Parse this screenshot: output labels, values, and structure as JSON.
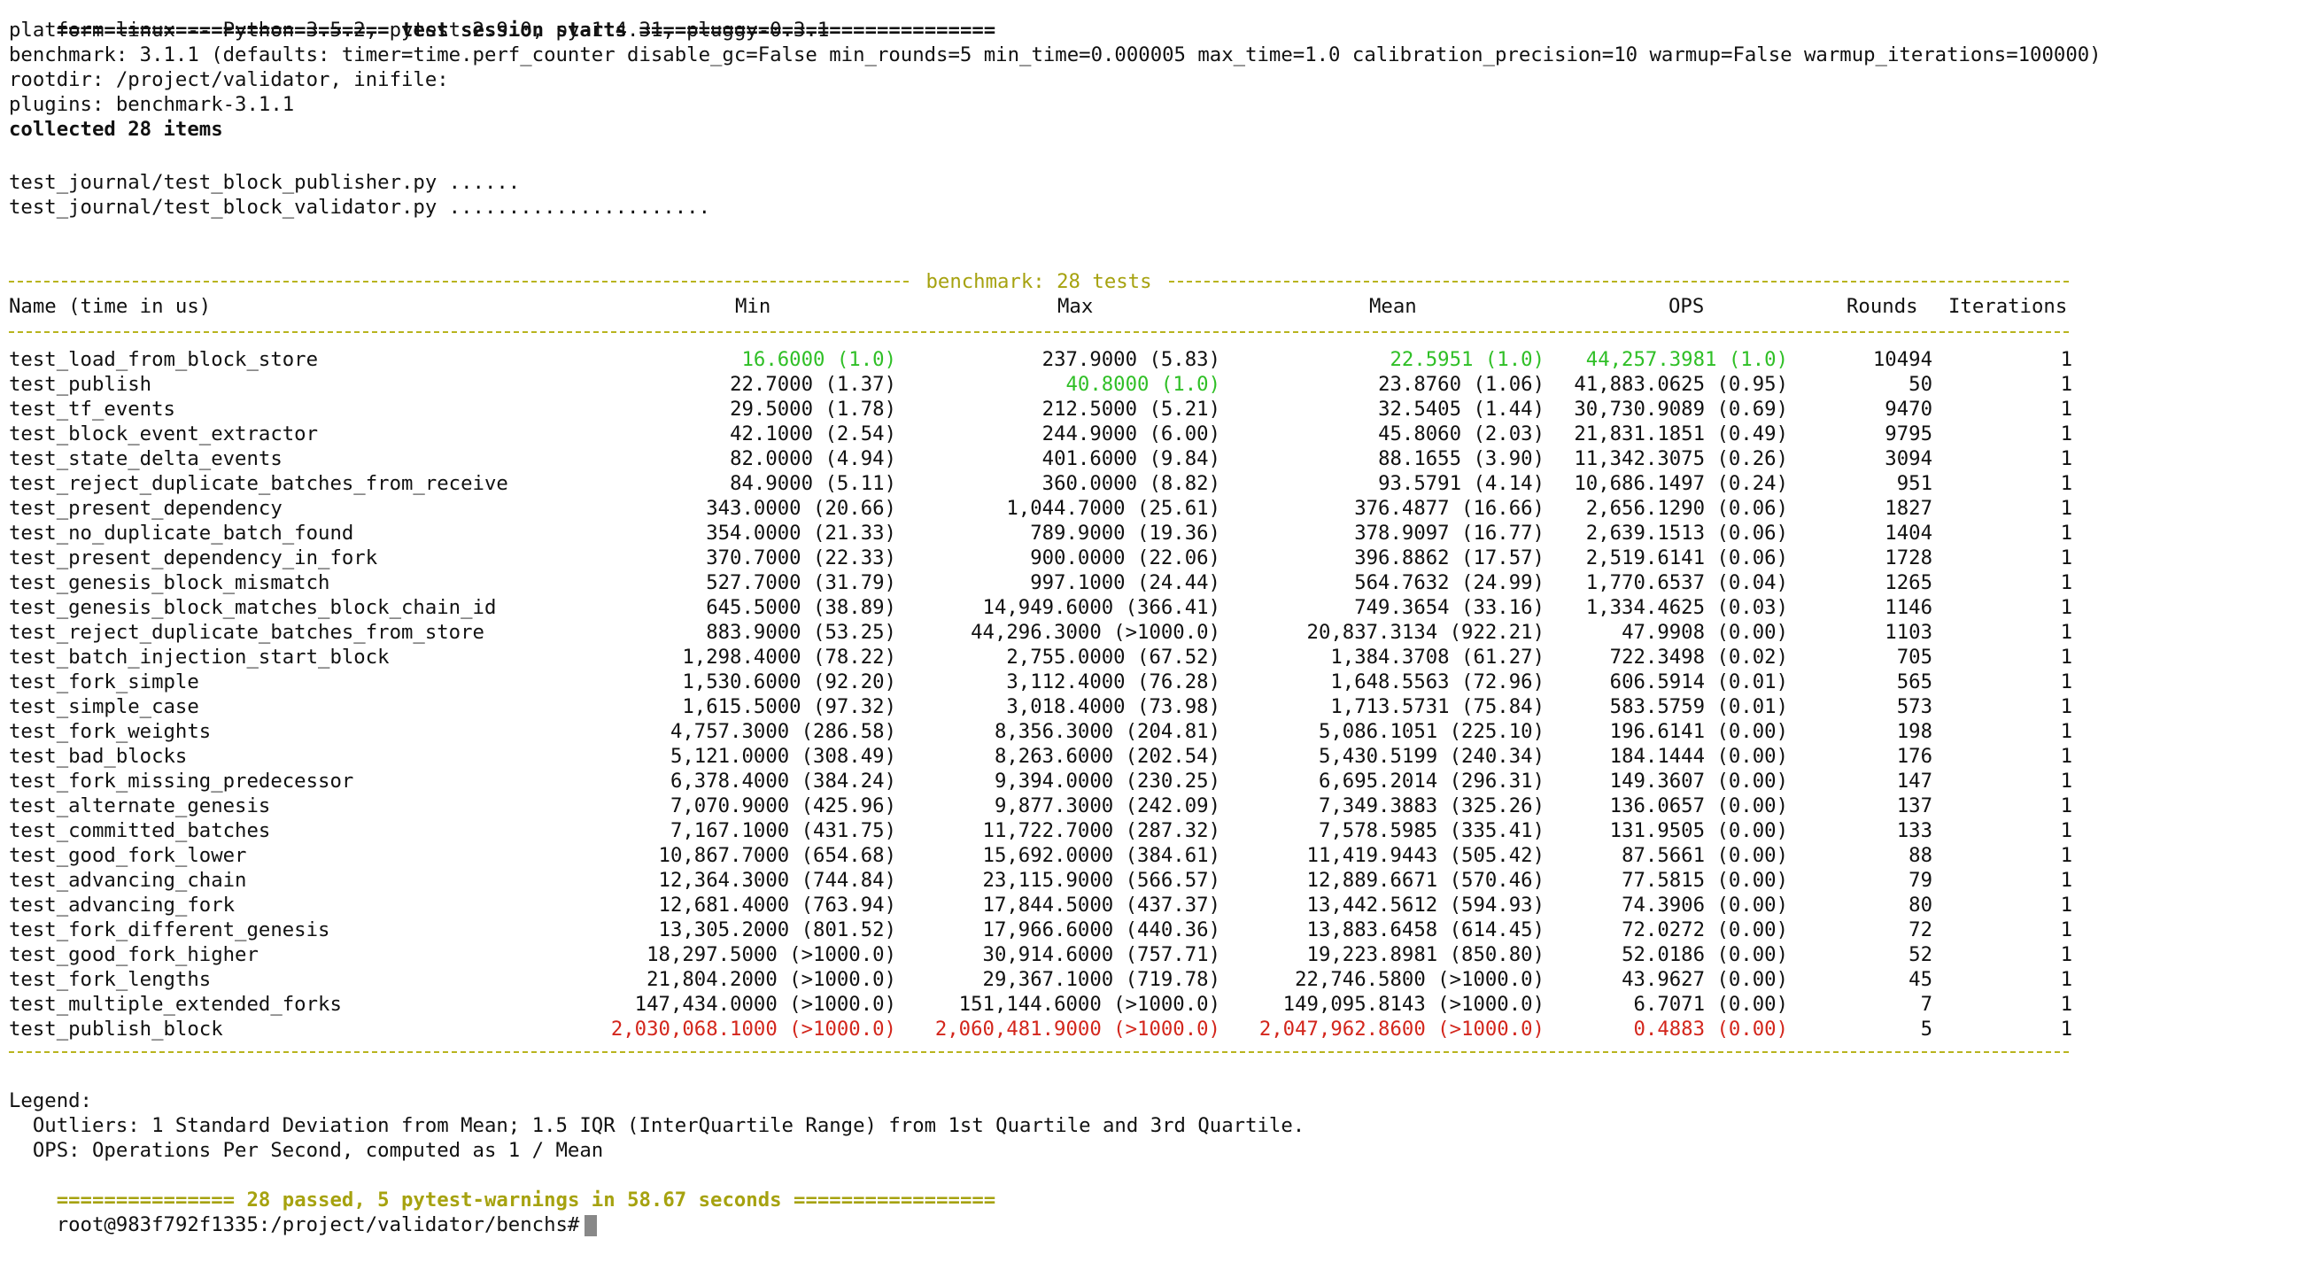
{
  "session_header": {
    "bar_left": "============================",
    "title": "test session starts",
    "bar_right": "=============================="
  },
  "platform_line": "platform linux -- Python 3.5.2, pytest-2.9.0, py-1.4.31, pluggy-0.3.1",
  "benchmark_line": "benchmark: 3.1.1 (defaults: timer=time.perf_counter disable_gc=False min_rounds=5 min_time=0.000005 max_time=1.0 calibration_precision=10 warmup=False warmup_iterations=100000)",
  "rootdir_line": "rootdir: /project/validator, inifile:",
  "plugins_line": "plugins: benchmark-3.1.1",
  "collected_line": "collected 28 items",
  "test_files": [
    "test_journal/test_block_publisher.py ......",
    "test_journal/test_block_validator.py ......................"
  ],
  "bench_table": {
    "title": "benchmark: 28 tests",
    "headers": {
      "name": "Name (time in us)",
      "min": "Min",
      "max": "Max",
      "mean": "Mean",
      "ops": "OPS",
      "rounds": "Rounds",
      "iterations": "Iterations"
    },
    "rows": [
      {
        "name": "test_load_from_block_store",
        "min": "16.6000 (1.0)",
        "max": "237.9000 (5.83)",
        "mean": "22.5951 (1.0)",
        "ops": "44,257.3981 (1.0)",
        "rounds": "10494",
        "iterations": "1"
      },
      {
        "name": "test_publish",
        "min": "22.7000 (1.37)",
        "max": "40.8000 (1.0)",
        "mean": "23.8760 (1.06)",
        "ops": "41,883.0625 (0.95)",
        "rounds": "50",
        "iterations": "1"
      },
      {
        "name": "test_tf_events",
        "min": "29.5000 (1.78)",
        "max": "212.5000 (5.21)",
        "mean": "32.5405 (1.44)",
        "ops": "30,730.9089 (0.69)",
        "rounds": "9470",
        "iterations": "1"
      },
      {
        "name": "test_block_event_extractor",
        "min": "42.1000 (2.54)",
        "max": "244.9000 (6.00)",
        "mean": "45.8060 (2.03)",
        "ops": "21,831.1851 (0.49)",
        "rounds": "9795",
        "iterations": "1"
      },
      {
        "name": "test_state_delta_events",
        "min": "82.0000 (4.94)",
        "max": "401.6000 (9.84)",
        "mean": "88.1655 (3.90)",
        "ops": "11,342.3075 (0.26)",
        "rounds": "3094",
        "iterations": "1"
      },
      {
        "name": "test_reject_duplicate_batches_from_receive",
        "min": "84.9000 (5.11)",
        "max": "360.0000 (8.82)",
        "mean": "93.5791 (4.14)",
        "ops": "10,686.1497 (0.24)",
        "rounds": "951",
        "iterations": "1"
      },
      {
        "name": "test_present_dependency",
        "min": "343.0000 (20.66)",
        "max": "1,044.7000 (25.61)",
        "mean": "376.4877 (16.66)",
        "ops": "2,656.1290 (0.06)",
        "rounds": "1827",
        "iterations": "1"
      },
      {
        "name": "test_no_duplicate_batch_found",
        "min": "354.0000 (21.33)",
        "max": "789.9000 (19.36)",
        "mean": "378.9097 (16.77)",
        "ops": "2,639.1513 (0.06)",
        "rounds": "1404",
        "iterations": "1"
      },
      {
        "name": "test_present_dependency_in_fork",
        "min": "370.7000 (22.33)",
        "max": "900.0000 (22.06)",
        "mean": "396.8862 (17.57)",
        "ops": "2,519.6141 (0.06)",
        "rounds": "1728",
        "iterations": "1"
      },
      {
        "name": "test_genesis_block_mismatch",
        "min": "527.7000 (31.79)",
        "max": "997.1000 (24.44)",
        "mean": "564.7632 (24.99)",
        "ops": "1,770.6537 (0.04)",
        "rounds": "1265",
        "iterations": "1"
      },
      {
        "name": "test_genesis_block_matches_block_chain_id",
        "min": "645.5000 (38.89)",
        "max": "14,949.6000 (366.41)",
        "mean": "749.3654 (33.16)",
        "ops": "1,334.4625 (0.03)",
        "rounds": "1146",
        "iterations": "1"
      },
      {
        "name": "test_reject_duplicate_batches_from_store",
        "min": "883.9000 (53.25)",
        "max": "44,296.3000 (>1000.0)",
        "mean": "20,837.3134 (922.21)",
        "ops": "47.9908 (0.00)",
        "rounds": "1103",
        "iterations": "1"
      },
      {
        "name": "test_batch_injection_start_block",
        "min": "1,298.4000 (78.22)",
        "max": "2,755.0000 (67.52)",
        "mean": "1,384.3708 (61.27)",
        "ops": "722.3498 (0.02)",
        "rounds": "705",
        "iterations": "1"
      },
      {
        "name": "test_fork_simple",
        "min": "1,530.6000 (92.20)",
        "max": "3,112.4000 (76.28)",
        "mean": "1,648.5563 (72.96)",
        "ops": "606.5914 (0.01)",
        "rounds": "565",
        "iterations": "1"
      },
      {
        "name": "test_simple_case",
        "min": "1,615.5000 (97.32)",
        "max": "3,018.4000 (73.98)",
        "mean": "1,713.5731 (75.84)",
        "ops": "583.5759 (0.01)",
        "rounds": "573",
        "iterations": "1"
      },
      {
        "name": "test_fork_weights",
        "min": "4,757.3000 (286.58)",
        "max": "8,356.3000 (204.81)",
        "mean": "5,086.1051 (225.10)",
        "ops": "196.6141 (0.00)",
        "rounds": "198",
        "iterations": "1"
      },
      {
        "name": "test_bad_blocks",
        "min": "5,121.0000 (308.49)",
        "max": "8,263.6000 (202.54)",
        "mean": "5,430.5199 (240.34)",
        "ops": "184.1444 (0.00)",
        "rounds": "176",
        "iterations": "1"
      },
      {
        "name": "test_fork_missing_predecessor",
        "min": "6,378.4000 (384.24)",
        "max": "9,394.0000 (230.25)",
        "mean": "6,695.2014 (296.31)",
        "ops": "149.3607 (0.00)",
        "rounds": "147",
        "iterations": "1"
      },
      {
        "name": "test_alternate_genesis",
        "min": "7,070.9000 (425.96)",
        "max": "9,877.3000 (242.09)",
        "mean": "7,349.3883 (325.26)",
        "ops": "136.0657 (0.00)",
        "rounds": "137",
        "iterations": "1"
      },
      {
        "name": "test_committed_batches",
        "min": "7,167.1000 (431.75)",
        "max": "11,722.7000 (287.32)",
        "mean": "7,578.5985 (335.41)",
        "ops": "131.9505 (0.00)",
        "rounds": "133",
        "iterations": "1"
      },
      {
        "name": "test_good_fork_lower",
        "min": "10,867.7000 (654.68)",
        "max": "15,692.0000 (384.61)",
        "mean": "11,419.9443 (505.42)",
        "ops": "87.5661 (0.00)",
        "rounds": "88",
        "iterations": "1"
      },
      {
        "name": "test_advancing_chain",
        "min": "12,364.3000 (744.84)",
        "max": "23,115.9000 (566.57)",
        "mean": "12,889.6671 (570.46)",
        "ops": "77.5815 (0.00)",
        "rounds": "79",
        "iterations": "1"
      },
      {
        "name": "test_advancing_fork",
        "min": "12,681.4000 (763.94)",
        "max": "17,844.5000 (437.37)",
        "mean": "13,442.5612 (594.93)",
        "ops": "74.3906 (0.00)",
        "rounds": "80",
        "iterations": "1"
      },
      {
        "name": "test_fork_different_genesis",
        "min": "13,305.2000 (801.52)",
        "max": "17,966.6000 (440.36)",
        "mean": "13,883.6458 (614.45)",
        "ops": "72.0272 (0.00)",
        "rounds": "72",
        "iterations": "1"
      },
      {
        "name": "test_good_fork_higher",
        "min": "18,297.5000 (>1000.0)",
        "max": "30,914.6000 (757.71)",
        "mean": "19,223.8981 (850.80)",
        "ops": "52.0186 (0.00)",
        "rounds": "52",
        "iterations": "1"
      },
      {
        "name": "test_fork_lengths",
        "min": "21,804.2000 (>1000.0)",
        "max": "29,367.1000 (719.78)",
        "mean": "22,746.5800 (>1000.0)",
        "ops": "43.9627 (0.00)",
        "rounds": "45",
        "iterations": "1"
      },
      {
        "name": "test_multiple_extended_forks",
        "min": "147,434.0000 (>1000.0)",
        "max": "151,144.6000 (>1000.0)",
        "mean": "149,095.8143 (>1000.0)",
        "ops": "6.7071 (0.00)",
        "rounds": "7",
        "iterations": "1"
      },
      {
        "name": "test_publish_block",
        "min": "2,030,068.1000 (>1000.0)",
        "max": "2,060,481.9000 (>1000.0)",
        "mean": "2,047,962.8600 (>1000.0)",
        "ops": "0.4883 (0.00)",
        "rounds": "5",
        "iterations": "1"
      }
    ],
    "highlight": {
      "min_best_row": 0,
      "max_best_row": 1,
      "mean_best_row": 0,
      "ops_best_row": 0,
      "worst_row": 27
    }
  },
  "legend": {
    "title": "Legend:",
    "outliers": "  Outliers: 1 Standard Deviation from Mean; 1.5 IQR (InterQuartile Range) from 1st Quartile and 3rd Quartile.",
    "ops": "  OPS: Operations Per Second, computed as 1 / Mean"
  },
  "summary": {
    "bar_left": "===============",
    "text": "28 passed, 5 pytest-warnings in 58.67 seconds",
    "bar_right": "================="
  },
  "prompt": "root@983f792f1335:/project/validator/benchs#",
  "colors": {
    "best": "#2fbf26",
    "worst": "#d3261c",
    "accent": "#a6a20f",
    "text": "#111111"
  },
  "icons": {
    "cursor": "block-cursor-icon"
  }
}
